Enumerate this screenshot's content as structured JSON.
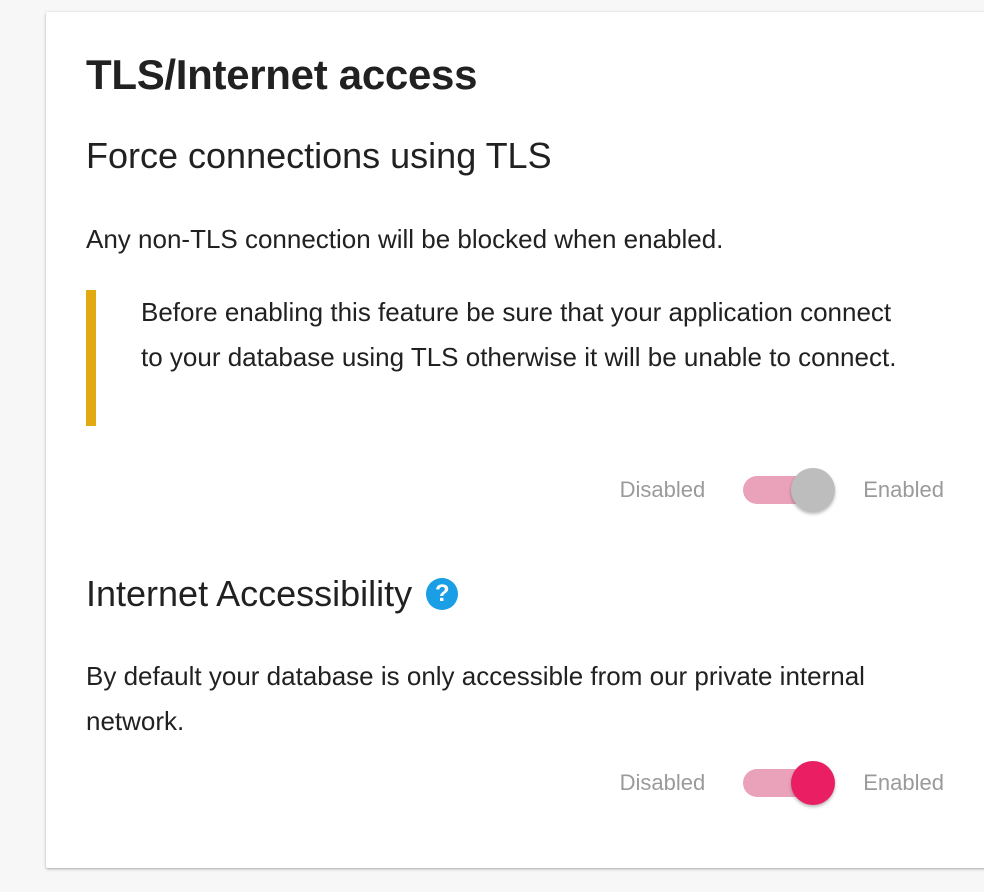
{
  "card": {
    "title": "TLS/Internet access",
    "tls": {
      "heading": "Force connections using TLS",
      "description": "Any non-TLS connection will be blocked when enabled.",
      "warning": "Before enabling this feature be sure that your application connect to your database using TLS otherwise it will be unable to connect.",
      "toggle": {
        "off_label": "Disabled",
        "on_label": "Enabled",
        "state": "enabled-grey"
      }
    },
    "internet": {
      "heading": "Internet Accessibility",
      "help_icon": "question-circle-icon",
      "help_glyph": "?",
      "description": "By default your database is only accessible from our private internal network.",
      "toggle": {
        "off_label": "Disabled",
        "on_label": "Enabled",
        "state": "enabled"
      }
    }
  },
  "colors": {
    "warning_bar": "#e0aa10",
    "toggle_track": "#e9a2b9",
    "toggle_thumb_active": "#e91e63",
    "toggle_thumb_grey": "#bdbdbd",
    "help_icon": "#1a9ee6"
  }
}
